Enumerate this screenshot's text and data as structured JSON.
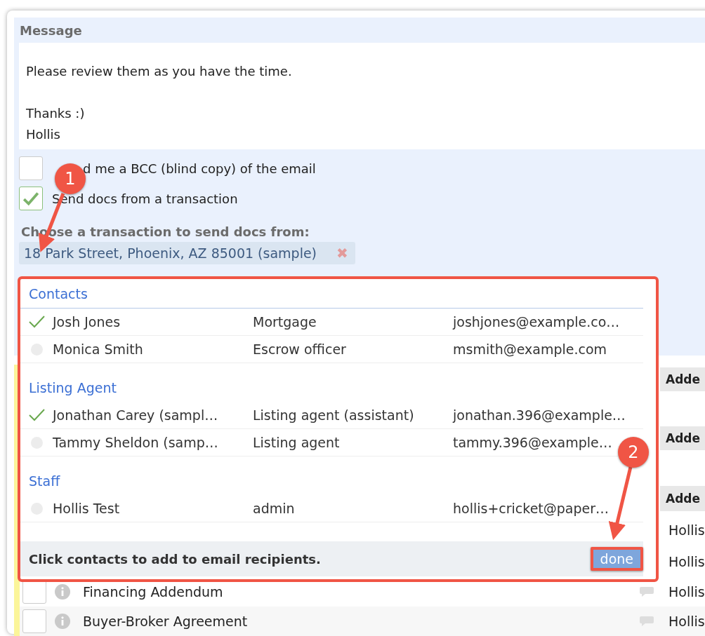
{
  "message": {
    "label": "Message",
    "text": "Please review them as you have the time.\n\nThanks :)\nHollis"
  },
  "options": [
    {
      "label": "d me a BCC (blind copy) of the email",
      "checked": false
    },
    {
      "label": "Send docs from a transaction",
      "checked": true
    }
  ],
  "transaction": {
    "label": "Choose a transaction to send docs from:",
    "value": "18 Park Street, Phoenix, AZ 85001 (sample)",
    "remove": "✖"
  },
  "contact_picker": {
    "groups": [
      {
        "title": "Contacts",
        "contacts": [
          {
            "name": "Josh Jones",
            "role": "Mortgage",
            "email": "joshjones@example.co…",
            "selected": true
          },
          {
            "name": "Monica Smith",
            "role": "Escrow officer",
            "email": "msmith@example.com",
            "selected": false
          }
        ]
      },
      {
        "title": "Listing Agent",
        "contacts": [
          {
            "name": "Jonathan Carey (sampl…",
            "role": "Listing agent (assistant)",
            "email": "jonathan.396@example…",
            "selected": true
          },
          {
            "name": "Tammy Sheldon (samp…",
            "role": "Listing agent",
            "email": "tammy.396@example…",
            "selected": false
          }
        ]
      },
      {
        "title": "Staff",
        "contacts": [
          {
            "name": "Hollis Test",
            "role": "admin",
            "email": "hollis+cricket@paper…",
            "selected": false
          }
        ]
      }
    ],
    "hint": "Click contacts to add to email recipients.",
    "done": "done"
  },
  "background_rows": [
    {
      "kind": "button",
      "label": "Adde"
    },
    {
      "kind": "button",
      "label": "Adde"
    },
    {
      "kind": "header",
      "label": "Adde"
    },
    {
      "kind": "owner",
      "label": "Hollis"
    },
    {
      "kind": "owner",
      "label": "Hollis"
    }
  ],
  "documents": [
    {
      "name": "Financing Addendum",
      "owner": "Hollis",
      "checked": false
    },
    {
      "name": "Buyer-Broker Agreement",
      "owner": "Hollis",
      "checked": false
    }
  ],
  "annotations": [
    {
      "label": "1"
    },
    {
      "label": "2"
    }
  ]
}
